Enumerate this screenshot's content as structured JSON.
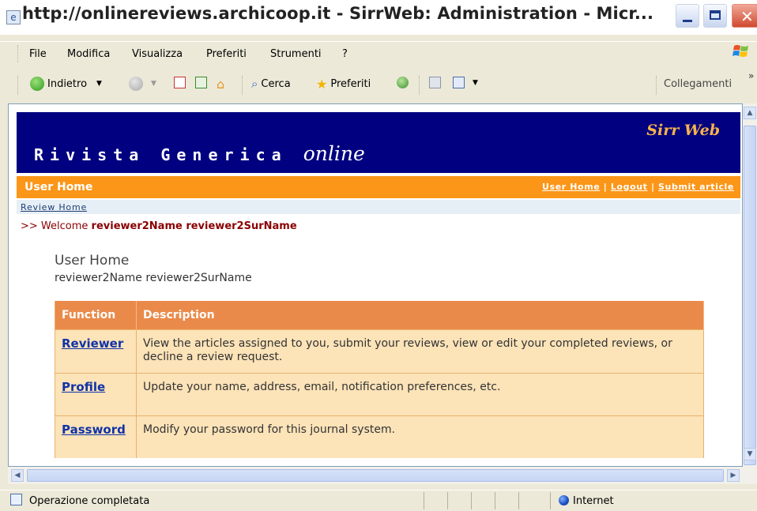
{
  "window": {
    "title": "http://onlinereviews.archicoop.it - SirrWeb: Administration - Micr..."
  },
  "menubar": {
    "items": [
      "File",
      "Modifica",
      "Visualizza",
      "Preferiti",
      "Strumenti",
      "?"
    ]
  },
  "toolbar": {
    "back_label": "Indietro",
    "search_label": "Cerca",
    "favorites_label": "Preferiti",
    "links_label": "Collegamenti"
  },
  "page": {
    "brand": "Sirr Web",
    "site_title_main": "Rivista Generica",
    "site_title_suffix": "online",
    "section_label": "User Home",
    "toplinks": {
      "user_home": "User Home",
      "logout": "Logout",
      "submit_article": "Submit article",
      "separator": "|"
    },
    "breadcrumb": "Review Home",
    "welcome_prefix": ">> Welcome",
    "welcome_name": "reviewer2Name reviewer2SurName",
    "heading": "User Home",
    "user_name": "reviewer2Name reviewer2SurName",
    "table": {
      "headers": [
        "Function",
        "Description"
      ],
      "rows": [
        {
          "function": "Reviewer",
          "description": "View the articles assigned to you, submit your reviews, view or edit your completed reviews, or decline a review request."
        },
        {
          "function": "Profile",
          "description": "Update your name, address, email, notification preferences, etc."
        },
        {
          "function": "Password",
          "description": "Modify your password for this journal system."
        }
      ]
    }
  },
  "statusbar": {
    "text": "Operazione completata",
    "zone": "Internet"
  },
  "colors": {
    "banner": "#000080",
    "orange_bar": "#fb9618",
    "table_header": "#ea8a4a",
    "table_cell": "#fce3b8",
    "brand": "#f7b24a"
  }
}
